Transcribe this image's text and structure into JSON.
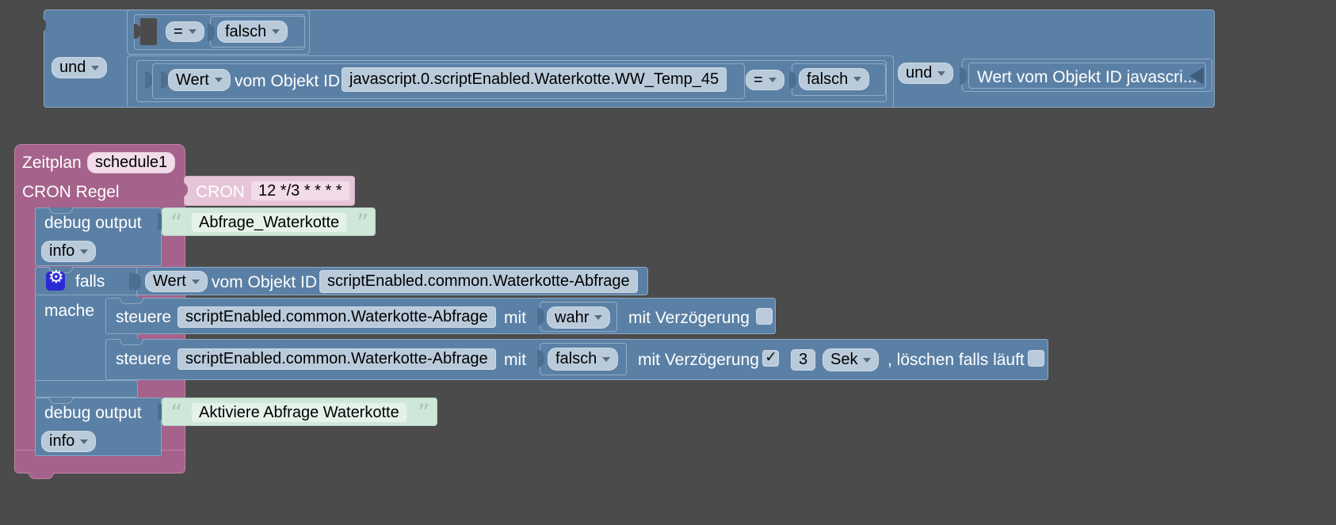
{
  "app": {
    "background_color": "#4b4b4b",
    "title": "Blockly script editor workspace"
  },
  "colors": {
    "logic_block": "#5b80a5",
    "hat_block": "#a5628a",
    "text_block": "#cfe7d8",
    "cron_block": "#e6c5d8",
    "field": "#b9cbdb",
    "gear_icon": "#2b2bd6"
  },
  "top_condition_block": {
    "name": "logic-and-group",
    "operator_label": "und",
    "row1": {
      "empty_socket": true,
      "compare_operator": "=",
      "compare_value": "falsch"
    },
    "row2": {
      "getter_mode": "Wert",
      "getter_text": "vom Objekt ID",
      "object_id": "javascript.0.scriptEnabled.Waterkotte.WW_Temp_45",
      "compare_operator": "=",
      "compare_value": "falsch",
      "second_operator": "und",
      "collapsed_block_label": "Wert vom Objekt ID javascri..."
    }
  },
  "schedule_block": {
    "name": "schedule-hat-block",
    "title": "Zeitplan",
    "schedule_id": "schedule1",
    "cron_rule_label": "CRON Regel",
    "cron_prefix": "CRON",
    "cron_expression": "12 */3 * * * *",
    "statements": {
      "debug_top": {
        "label": "debug output",
        "message": "Abfrage_Waterkotte",
        "severity": "info"
      },
      "if_block": {
        "mutator_icon": "gear-icon",
        "label": "falls",
        "condition": {
          "getter_mode": "Wert",
          "getter_text": "vom Objekt ID",
          "object_id": "scriptEnabled.common.Waterkotte-Abfrage"
        },
        "do_label": "mache",
        "actions": [
          {
            "label": "steuere",
            "object_id": "scriptEnabled.common.Waterkotte-Abfrage",
            "with_label": "mit",
            "value": "wahr",
            "delay_label": "mit Verzögerung",
            "delay_checked": false,
            "delay_amount": "",
            "delay_unit": "",
            "clear_label": "",
            "clear_checked": false
          },
          {
            "label": "steuere",
            "object_id": "scriptEnabled.common.Waterkotte-Abfrage",
            "with_label": "mit",
            "value": "falsch",
            "delay_label": "mit Verzögerung",
            "delay_checked": true,
            "delay_amount": "3",
            "delay_unit": "Sek",
            "clear_label": ", löschen falls läuft",
            "clear_checked": false
          }
        ]
      },
      "debug_bottom": {
        "label": "debug output",
        "message": "Aktiviere Abfrage Waterkotte",
        "severity": "info"
      }
    }
  }
}
